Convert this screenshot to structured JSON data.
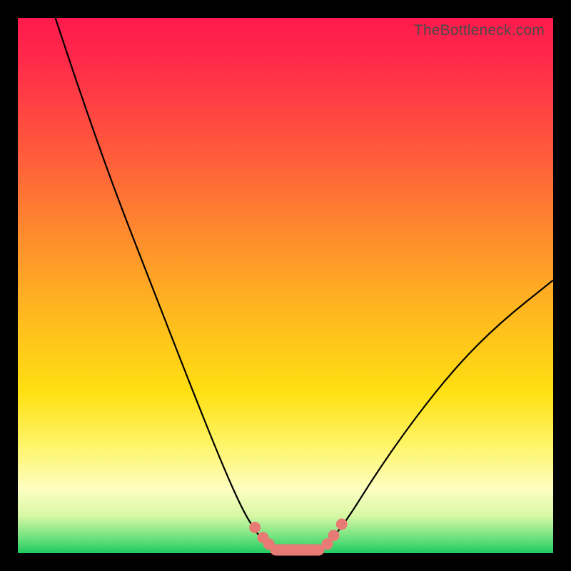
{
  "watermark": "TheBottleneck.com",
  "chart_data": {
    "type": "line",
    "title": "",
    "xlabel": "",
    "ylabel": "",
    "xlim": [
      0,
      100
    ],
    "ylim": [
      0,
      100
    ],
    "grid": false,
    "series": [
      {
        "name": "left-curve",
        "x": [
          7,
          12,
          18,
          25,
          32,
          38,
          42,
          44.5,
          46,
          48,
          50
        ],
        "values": [
          100,
          85,
          68,
          50,
          32,
          17,
          8,
          4,
          2,
          0.8,
          0.5
        ]
      },
      {
        "name": "right-curve",
        "x": [
          55,
          57,
          59,
          62,
          67,
          74,
          82,
          90,
          100
        ],
        "values": [
          0.5,
          1.2,
          3,
          7,
          15,
          25,
          35,
          43,
          51
        ]
      }
    ],
    "markers": [
      {
        "shape": "dot",
        "x": 44.3,
        "y": 4.8
      },
      {
        "shape": "dot",
        "x": 45.8,
        "y": 2.9
      },
      {
        "shape": "dot",
        "x": 46.9,
        "y": 1.7
      },
      {
        "shape": "capsule",
        "x0": 48.2,
        "x1": 56.2,
        "y": 0.6
      },
      {
        "shape": "dot",
        "x": 57.8,
        "y": 1.7
      },
      {
        "shape": "dot",
        "x": 59.0,
        "y": 3.3
      },
      {
        "shape": "dot",
        "x": 60.5,
        "y": 5.4
      }
    ],
    "colors": {
      "curve": "#000000",
      "marker": "#e77a74",
      "gradient_top": "#ff1a4d",
      "gradient_bottom": "#1fc95f"
    }
  }
}
